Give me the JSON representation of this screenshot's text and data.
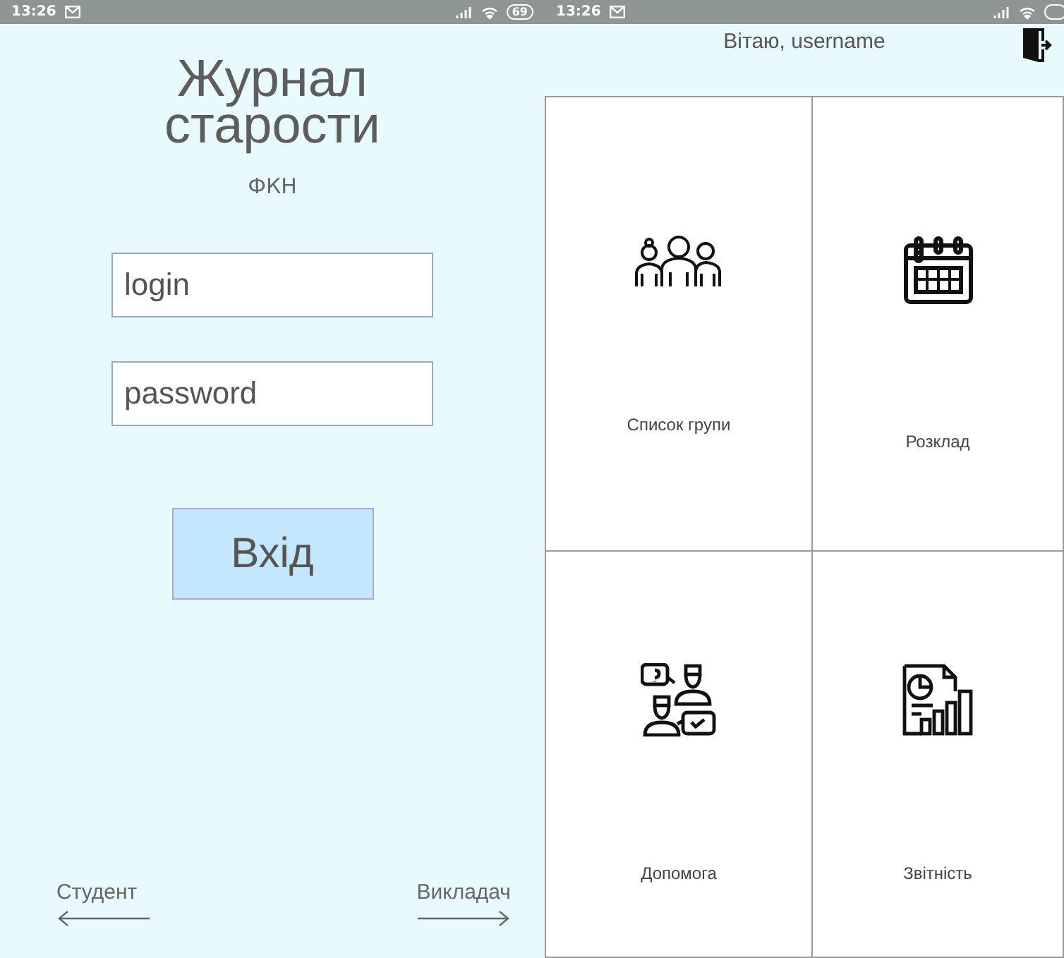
{
  "login_screen": {
    "status_bar": {
      "time": "13:26",
      "battery": "69"
    },
    "title": "Журнал старости",
    "subtitle": "ФКН",
    "fields": [
      {
        "placeholder": "login"
      },
      {
        "placeholder": "password"
      }
    ],
    "submit_button": "Вхід",
    "nav": [
      {
        "label": "Студент",
        "kind": "back"
      },
      {
        "label": "Викладач",
        "kind": "forward"
      }
    ]
  },
  "menu_screen": {
    "status_bar": {
      "time": "13:26"
    },
    "greeting": "Вітаю, username",
    "tiles": [
      {
        "label": "Список групи",
        "kind": "group"
      },
      {
        "label": "Розклад",
        "kind": "calendar"
      },
      {
        "label": "Допомога",
        "kind": "help"
      },
      {
        "label": "Звітність",
        "kind": "report"
      }
    ]
  }
}
